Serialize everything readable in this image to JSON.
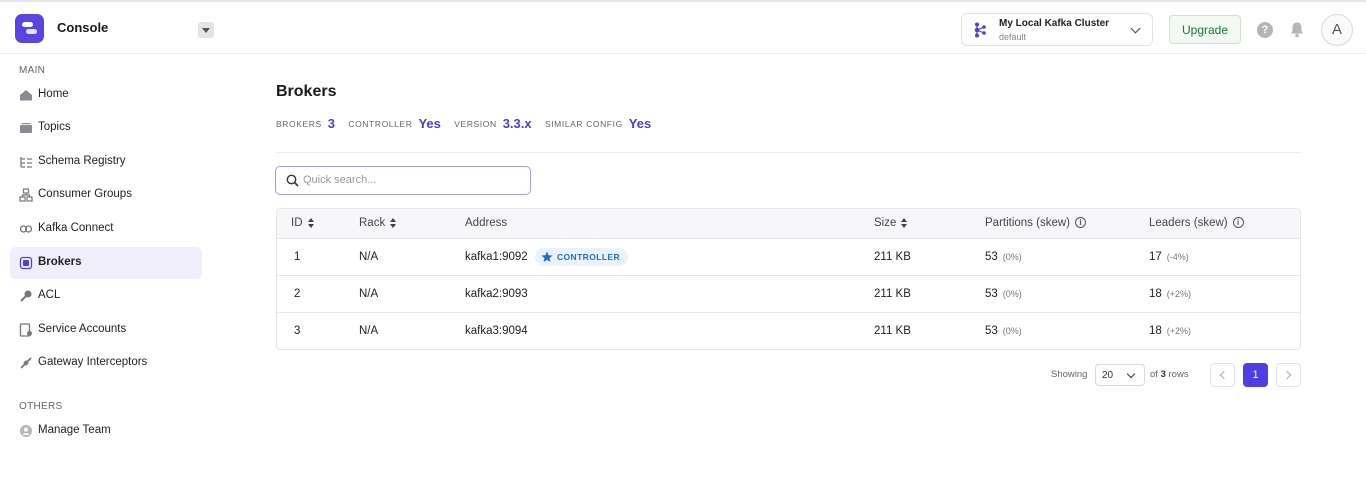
{
  "header": {
    "app_name": "Console",
    "cluster": {
      "name": "My Local Kafka Cluster",
      "environment": "default"
    },
    "upgrade_label": "Upgrade",
    "help_glyph": "?",
    "avatar_initial": "A"
  },
  "sidebar": {
    "main_label": "MAIN",
    "others_label": "OTHERS",
    "items": [
      {
        "label": "Home",
        "icon": "home-icon"
      },
      {
        "label": "Topics",
        "icon": "topics-icon"
      },
      {
        "label": "Schema Registry",
        "icon": "schema-registry-icon"
      },
      {
        "label": "Consumer Groups",
        "icon": "consumer-groups-icon"
      },
      {
        "label": "Kafka Connect",
        "icon": "kafka-connect-icon"
      },
      {
        "label": "Brokers",
        "icon": "brokers-icon",
        "active": true
      },
      {
        "label": "ACL",
        "icon": "key-icon"
      },
      {
        "label": "Service Accounts",
        "icon": "service-accounts-icon"
      },
      {
        "label": "Gateway Interceptors",
        "icon": "gateway-icon"
      }
    ],
    "other_items": [
      {
        "label": "Manage Team",
        "icon": "team-icon"
      }
    ]
  },
  "main": {
    "title": "Brokers",
    "stats": [
      {
        "label": "BROKERS",
        "value": "3"
      },
      {
        "label": "CONTROLLER",
        "value": "Yes"
      },
      {
        "label": "VERSION",
        "value": "3.3.x"
      },
      {
        "label": "SIMILAR CONFIG",
        "value": "Yes"
      }
    ],
    "search": {
      "placeholder": "Quick search...",
      "value": ""
    },
    "table": {
      "columns": [
        "ID",
        "Rack",
        "Address",
        "Size",
        "Partitions (skew)",
        "Leaders (skew)"
      ],
      "info_glyph": "i",
      "controller_badge": "CONTROLLER",
      "rows": [
        {
          "id": "1",
          "rack": "N/A",
          "address": "kafka1:9092",
          "size": "211 KB",
          "partitions": "53",
          "partitions_skew": "(0%)",
          "leaders": "17",
          "leaders_skew": "(-4%)"
        },
        {
          "id": "2",
          "rack": "N/A",
          "address": "kafka2:9093",
          "size": "211 KB",
          "partitions": "53",
          "partitions_skew": "(0%)",
          "leaders": "18",
          "leaders_skew": "(+2%)"
        },
        {
          "id": "3",
          "rack": "N/A",
          "address": "kafka3:9094",
          "size": "211 KB",
          "partitions": "53",
          "partitions_skew": "(0%)",
          "leaders": "18",
          "leaders_skew": "(+2%)"
        }
      ]
    },
    "pagination": {
      "showing_label": "Showing",
      "page_size": "20",
      "of_label": "of",
      "total_rows": "3",
      "rows_label": "rows",
      "current_page": "1"
    }
  },
  "colors": {
    "accent": "#4f3fe0",
    "stat_value": "#4b3ed0",
    "active_nav_bg": "#efeefa",
    "upgrade_text": "#1a7a33"
  }
}
